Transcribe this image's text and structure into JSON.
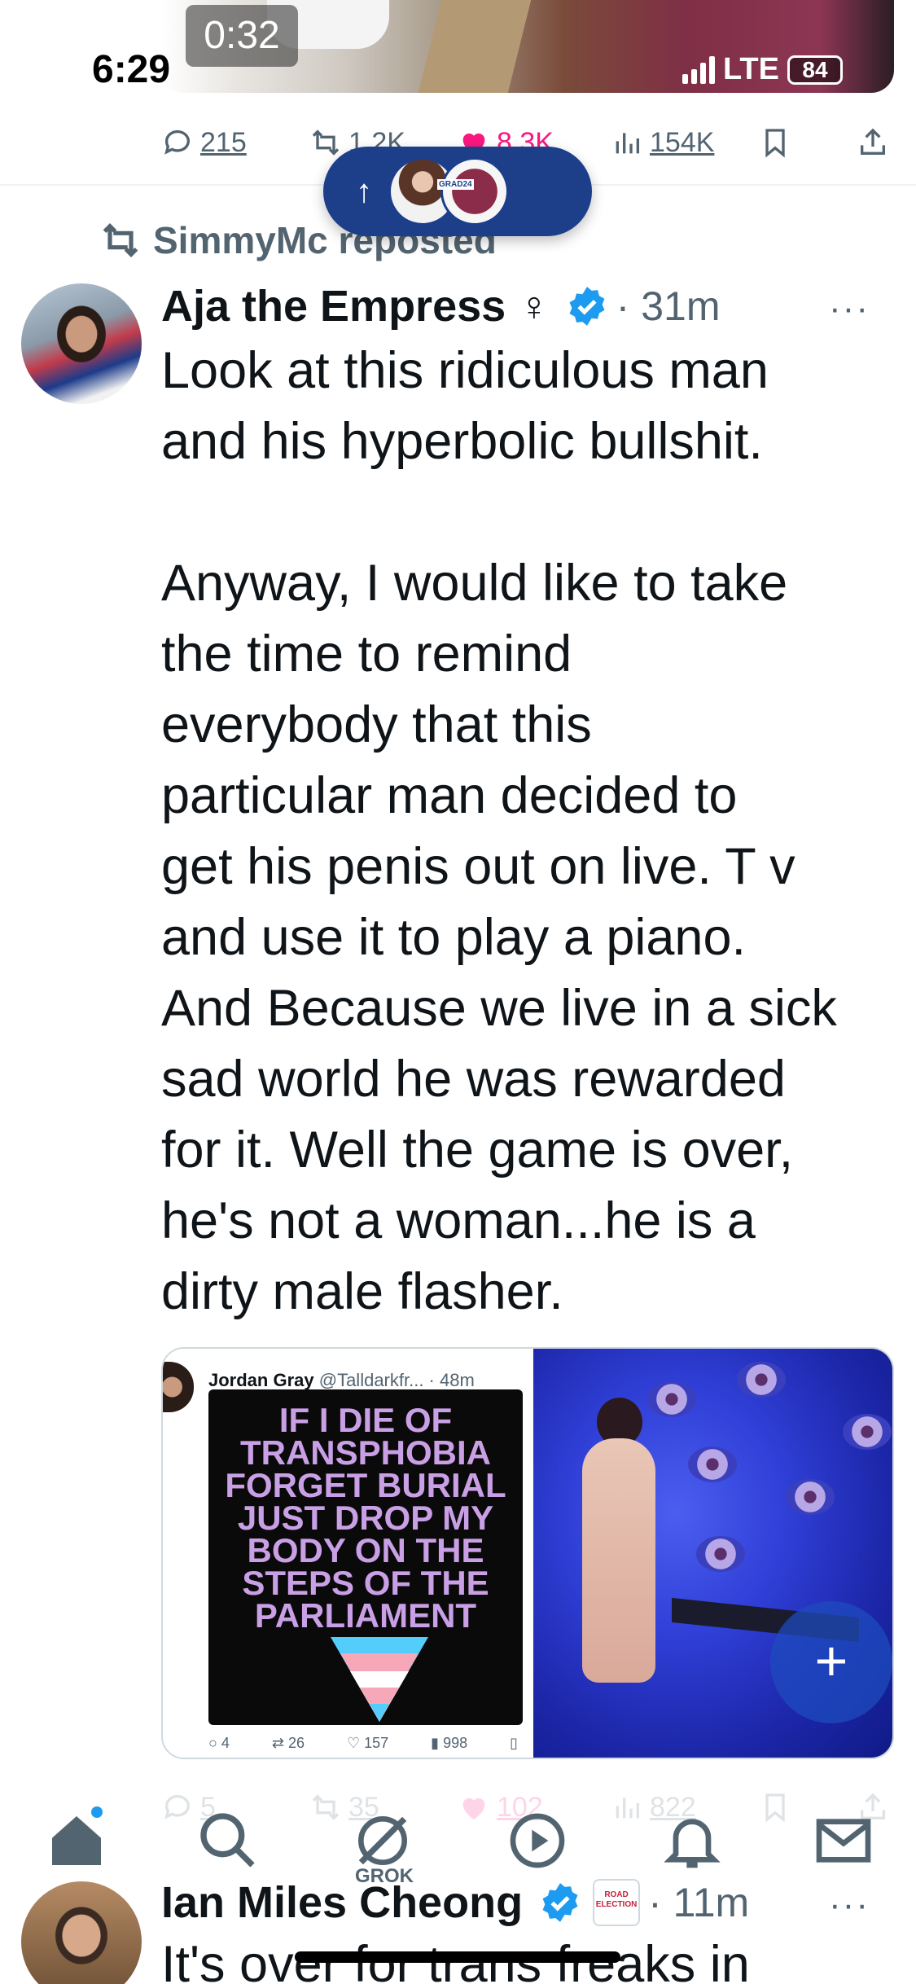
{
  "status_bar": {
    "time": "6:29",
    "network": "LTE",
    "battery": "84"
  },
  "video": {
    "timestamp": "0:32"
  },
  "prev_actions": {
    "replies": "215",
    "reposts": "1.2K",
    "likes": "8.3K",
    "views": "154K"
  },
  "new_posts_pill": {
    "tag": "GRAD24"
  },
  "repost_header": {
    "text": "SimmyMc reposted"
  },
  "post": {
    "author": "Aja the Empress",
    "gender_symbol": "♀",
    "time": "31m",
    "more": "···",
    "text": "Look at this ridiculous man\nand his hyperbolic bullshit.\n\nAnyway, I would like to take\nthe time to remind\neverybody that this\nparticular man decided to\nget his penis out on live. T v\nand use it to play a piano.\nAnd Because we live in a sick\nsad world he was rewarded\nfor it. Well the game is over,\nhe's not a woman...he is a\ndirty male flasher.",
    "quoted": {
      "author": "Jordan Gray",
      "handle": "@Talldarkfr...",
      "time": "48m",
      "image_text": "IF I DIE OF\nTRANSPHOBIA\nFORGET BURIAL\nJUST DROP MY\nBODY ON THE\nSTEPS OF THE\nPARLIAMENT",
      "stats": {
        "replies": "4",
        "reposts": "26",
        "likes": "157",
        "views": "998"
      }
    },
    "actions": {
      "replies": "5",
      "reposts": "35",
      "likes": "102",
      "views": "822"
    }
  },
  "fab": {
    "label": "+"
  },
  "bottom_nav": {
    "grok_label": "GROK"
  },
  "next_post": {
    "author": "Ian Miles Cheong",
    "badge": "ROAD\nELECTION",
    "time": "11m",
    "more": "···",
    "text_preview": "It's over for trans freaks in"
  },
  "colors": {
    "like": "#f91880",
    "muted": "#536471",
    "verified": "#1d9bf0",
    "pill": "#1d3f8a"
  }
}
